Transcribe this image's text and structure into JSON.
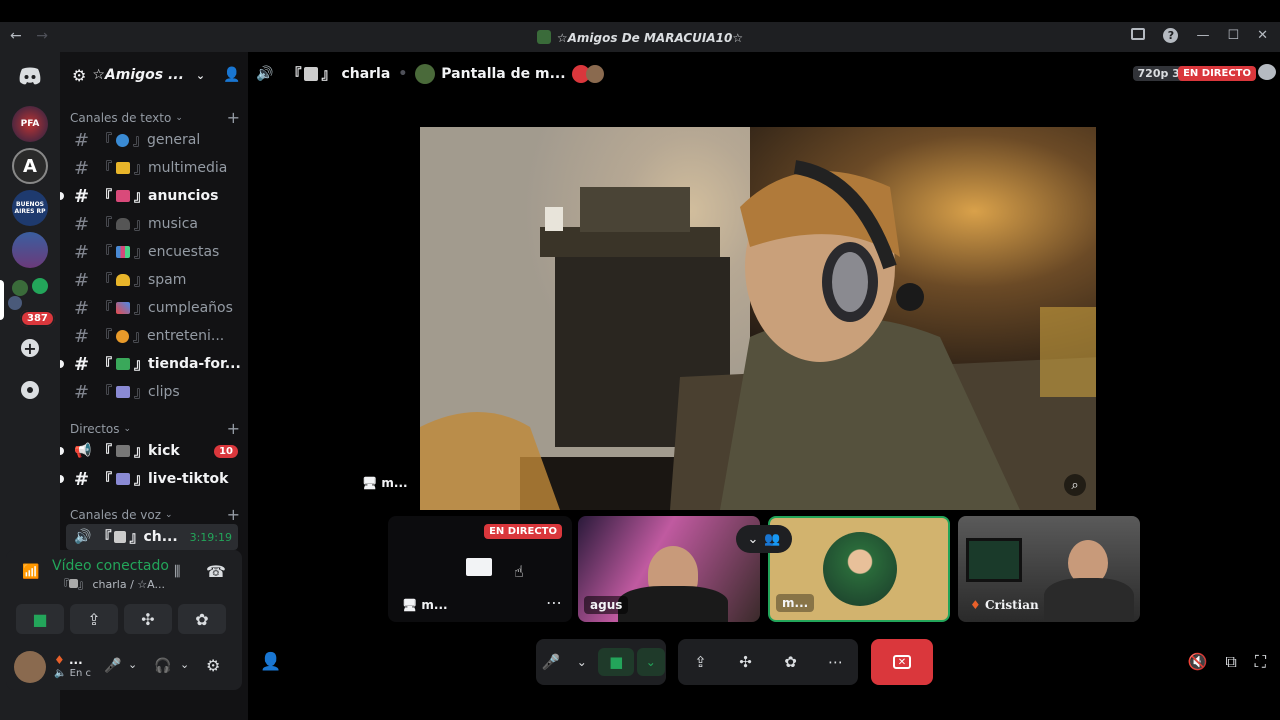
{
  "window": {
    "title": "☆Amigos De MARACUIA10☆",
    "nav_back": "←",
    "nav_forward": "→"
  },
  "rail": {
    "badge_count": "387",
    "servers": [
      "PFA",
      "A",
      "BUENOS AIRES RP",
      "",
      ""
    ]
  },
  "guild": {
    "name": "☆Amigos ..."
  },
  "sidebar": {
    "text_category": "Canales de texto",
    "text_channels": [
      {
        "label": "general",
        "bold": false
      },
      {
        "label": "multimedia",
        "bold": false
      },
      {
        "label": "anuncios",
        "bold": true
      },
      {
        "label": "musica",
        "bold": false
      },
      {
        "label": "encuestas",
        "bold": false
      },
      {
        "label": "spam",
        "bold": false
      },
      {
        "label": "cumpleaños",
        "bold": false
      },
      {
        "label": "entreteni...",
        "bold": false
      },
      {
        "label": "tienda-for...",
        "bold": true
      },
      {
        "label": "clips",
        "bold": false
      }
    ],
    "direct_category": "Directos",
    "direct_channels": [
      {
        "label": "kick",
        "badge": "10"
      },
      {
        "label": "live-tiktok"
      }
    ],
    "voice_category": "Canales de voz",
    "voice_channel": {
      "label": "ch...",
      "time": "3:19:19"
    }
  },
  "voice_panel": {
    "status": "Vídeo conectado",
    "location": "charla / ☆A...",
    "user_name": "...",
    "user_status": "En c"
  },
  "topbar": {
    "channel": "charla",
    "stream": "Pantalla de m...",
    "quality": "720p 30FPS",
    "live": "EN DIRECTO"
  },
  "stage": {
    "main_label": "m..."
  },
  "tiles": [
    {
      "label": "m...",
      "live": "EN DIRECTO"
    },
    {
      "label": "agus"
    },
    {
      "label": "m..."
    },
    {
      "label": "Cristian"
    }
  ],
  "colors": {
    "accent_green": "#23a55a",
    "danger": "#da373c",
    "bg": "#000000",
    "sidebar": "#121214"
  }
}
